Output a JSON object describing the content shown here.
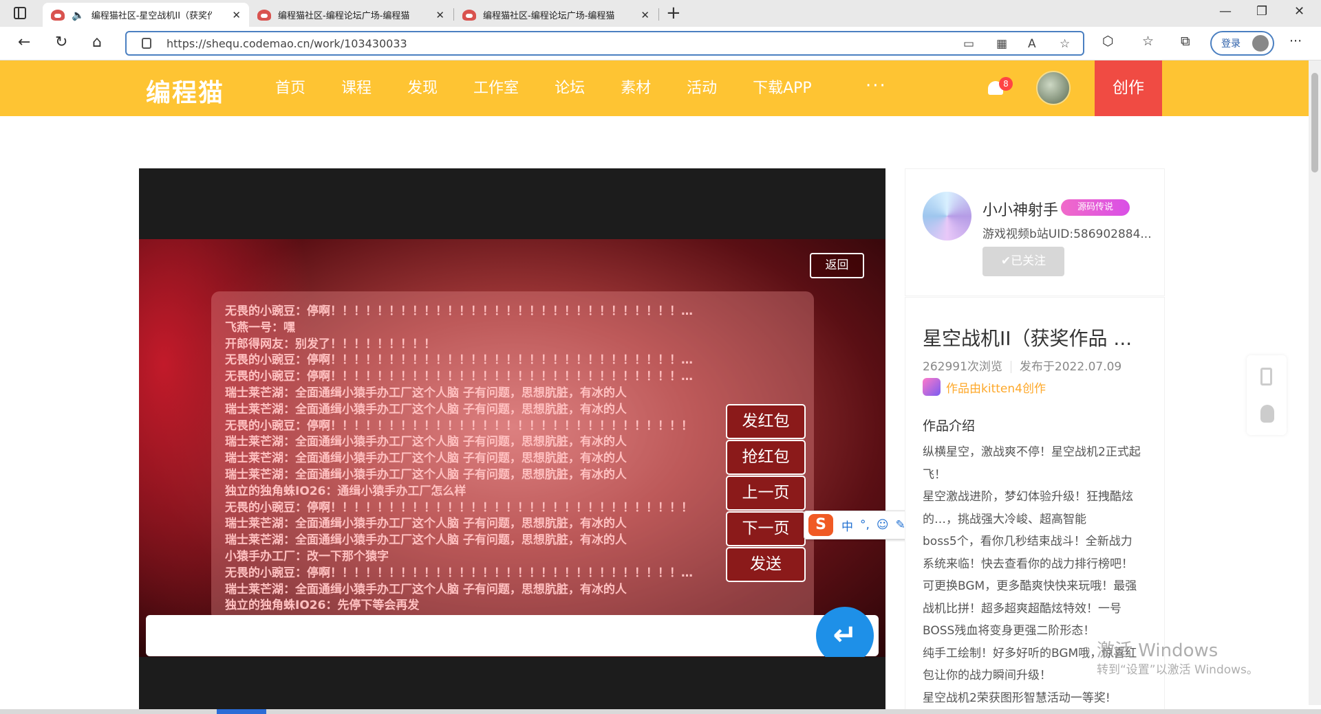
{
  "browser": {
    "tabs": [
      {
        "title": "编程猫社区-星空战机II（获奖作品）",
        "active": true,
        "audio": true
      },
      {
        "title": "编程猫社区-编程论坛广场-编程猫",
        "active": false
      },
      {
        "title": "编程猫社区-编程论坛广场-编程猫",
        "active": false
      }
    ],
    "url": "https://shequ.codemao.cn/work/103430033",
    "login_label": "登录",
    "icons": [
      "tab-actions-icon",
      "speaker-icon",
      "close-icon",
      "plus-icon",
      "minimize-icon",
      "maximize-icon",
      "window-close-icon",
      "back-icon",
      "reload-icon",
      "home-icon",
      "lock-icon",
      "app-available-icon",
      "apps-icon",
      "read-aloud-icon",
      "add-favorite-icon",
      "extensions-icon",
      "favorites-icon",
      "collections-icon",
      "more-icon"
    ]
  },
  "site": {
    "logo": "编程猫",
    "nav": [
      "首页",
      "课程",
      "发现",
      "工作室",
      "论坛",
      "素材",
      "活动",
      "下载APP"
    ],
    "more": "···",
    "notif_count": "8",
    "create_label": "创作"
  },
  "game": {
    "back_label": "返回",
    "chat_lines": [
      "无畏的小豌豆：停啊！！！！！！！！！！！！！！！！！！！！！！！！！！！！！！…",
      "飞燕一号：嘿",
      "开郎得网友：别发了！！！！！！！！！",
      "无畏的小豌豆：停啊！！！！！！！！！！！！！！！！！！！！！！！！！！！！！！…",
      "无畏的小豌豆：停啊！！！！！！！！！！！！！！！！！！！！！！！！！！！！！！…",
      "瑞士莱芒湖：全面通缉小猿手办工厂这个人脑 子有问题，思想肮脏，有冰的人",
      "瑞士莱芒湖：全面通缉小猿手办工厂这个人脑 子有问题，思想肮脏，有冰的人",
      "无畏的小豌豆：停啊！！！！！！！！！！！！！！！！！！！！！！！！！！！！！！！",
      "瑞士莱芒湖：全面通缉小猿手办工厂这个人脑 子有问题，思想肮脏，有冰的人",
      "瑞士莱芒湖：全面通缉小猿手办工厂这个人脑 子有问题，思想肮脏，有冰的人",
      "瑞士莱芒湖：全面通缉小猿手办工厂这个人脑 子有问题，思想肮脏，有冰的人",
      "独立的独角蛛IO26：通缉小猿手办工厂怎么样",
      "无畏的小豌豆：停啊！！！！！！！！！！！！！！！！！！！！！！！！！！！！！！！",
      "瑞士莱芒湖：全面通缉小猿手办工厂这个人脑 子有问题，思想肮脏，有冰的人",
      "瑞士莱芒湖：全面通缉小猿手办工厂这个人脑 子有问题，思想肮脏，有冰的人",
      "小猿手办工厂：改一下那个猿字",
      "无畏的小豌豆：停啊！！！！！！！！！！！！！！！！！！！！！！！！！！！！！！…",
      "瑞士莱芒湖：全面通缉小猿手办工厂这个人脑 子有问题，思想肮脏，有冰的人",
      "独立的独角蛛IO26：先停下等会再发"
    ],
    "buttons": {
      "send_red_packet": "发红包",
      "grab_red_packet": "抢红包",
      "prev_page": "上一页",
      "next_page": "下一页",
      "send": "发送"
    },
    "enter_icon": "↵"
  },
  "ime": {
    "logo": "S",
    "items": [
      "中",
      "°,",
      "☺",
      "✎",
      "🎤",
      "▦"
    ]
  },
  "author": {
    "name": "小小神射手",
    "badge": "源码传说",
    "uid": "游戏视频b站UID:586902884...",
    "follow_label": "✔已关注"
  },
  "work": {
    "title": "星空战机II（获奖作品 ...",
    "views": "262991次浏览",
    "published": "发布于2022.07.09",
    "creator": "作品由kitten4创作",
    "intro_title": "作品介绍",
    "intro_lines": [
      "纵横星空，激战爽不停！星空战机2正式起",
      "飞！",
      "星空激战进阶，梦幻体验升级！狂拽酷炫",
      "的…，挑战强大冷峻、超高智能",
      "boss5个，看你几秒结束战斗！全新战力",
      "系统来临！快去查看你的战力排行榜吧！",
      "可更换BGM，更多酷爽快快来玩哦！最强",
      "战机比拼！超多超爽超酷炫特效！一号",
      "BOSS残血将变身更强二阶形态！",
      "纯手工绘制！好多好听的BGM哦，惊喜红",
      "包让你的战力瞬间升级！",
      "星空战机2荣获图形智慧活动一等奖!"
    ]
  },
  "watermark": {
    "line1": "激活 Windows",
    "line2": "转到“设置”以激活 Windows。"
  }
}
